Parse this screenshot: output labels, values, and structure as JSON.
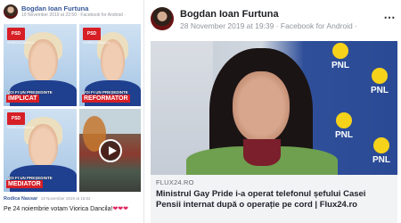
{
  "left_post": {
    "author": "Bogdan Ioan Furtuna",
    "meta": "19 November 2019 at 22:50 · Facebook for Android ·",
    "tiles": [
      {
        "badge": "PSD",
        "sub": "VIORICA DANCILA",
        "slogan_pre": "VOI FI UN PREȘEDINTE",
        "slogan": "IMPLICAT"
      },
      {
        "badge": "PSD",
        "sub": "VIORICA DANCILA",
        "slogan_pre": "VOI FI UN PREȘEDINTE",
        "slogan": "REFORMATOR"
      },
      {
        "badge": "PSD",
        "sub": "VIORICA DANCILA",
        "slogan_pre": "VOI FI UN PREȘEDINTE",
        "slogan": "MEDIATOR"
      }
    ],
    "comment": {
      "author": "Rodica Nassar",
      "meta": "19 November 2019 at 15:52 ·",
      "text": "Pe 24 noiembrie votam Viorica Dancila!",
      "hearts": "❤❤❤"
    }
  },
  "right_post": {
    "author": "Bogdan Ioan Furtuna",
    "meta": "28 November 2019 at 19:39 · Facebook for Android ·",
    "more_icon": "⋯",
    "photo_logos": [
      "PNL",
      "PNL",
      "PNL",
      "PNL"
    ],
    "link": {
      "domain": "FLUX24.RO",
      "headline": "Ministrul Gay Pride i-a operat telefonul șefului Casei Pensii internat după o operație pe cord | Flux24.ro"
    }
  },
  "colors": {
    "link_blue": "#385898",
    "psd_red": "#d71f26",
    "pnl_yellow": "#f7d21a",
    "pnl_blue": "#2f4f9a",
    "heart_red": "#e0245e"
  }
}
